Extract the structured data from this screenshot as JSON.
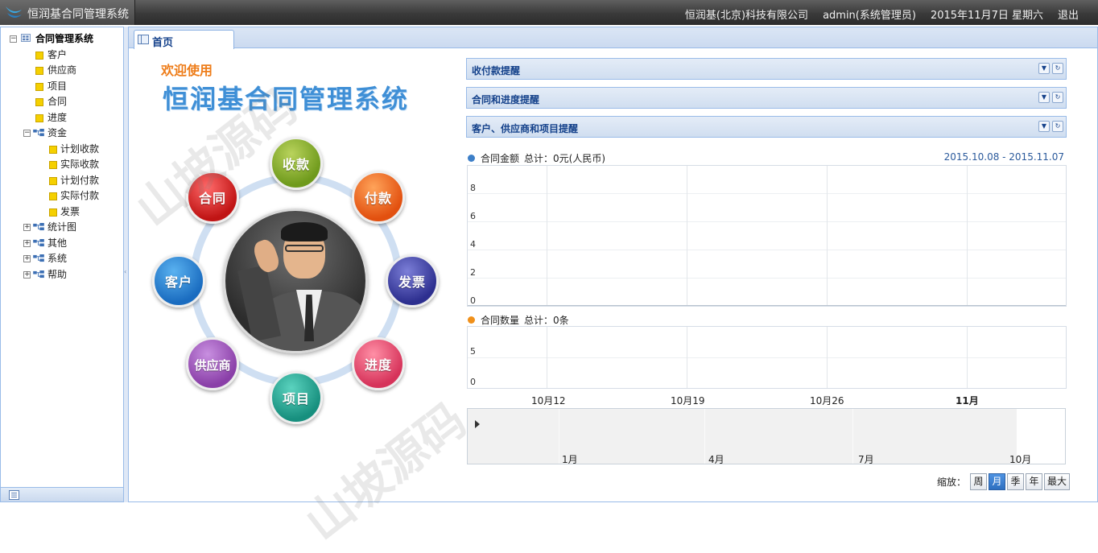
{
  "header": {
    "app_title": "恒润基合同管理系统",
    "company": "恒润基(北京)科技有限公司",
    "user": "admin(系统管理员)",
    "date": "2015年11月7日 星期六",
    "logout": "退出"
  },
  "sidebar": {
    "root": "合同管理系统",
    "items": [
      "客户",
      "供应商",
      "项目",
      "合同",
      "进度"
    ],
    "funds": {
      "label": "资金",
      "children": [
        "计划收款",
        "实际收款",
        "计划付款",
        "实际付款",
        "发票"
      ]
    },
    "collapsed": [
      "统计图",
      "其他",
      "系统",
      "帮助"
    ]
  },
  "tab": {
    "label": "首页"
  },
  "welcome": {
    "line1": "欢迎使用",
    "line2": "恒润基合同管理系统"
  },
  "watermark": "山坡源码",
  "orbit": {
    "shou": "收款",
    "fu": "付款",
    "fa": "发票",
    "jin": "进度",
    "xm": "项目",
    "gys": "供应商",
    "kh": "客户",
    "ht": "合同"
  },
  "panels": [
    "收付款提醒",
    "合同和进度提醒",
    "客户、供应商和项目提醒"
  ],
  "chart_data": [
    {
      "type": "line",
      "legend": "合同金额",
      "summary": "总计：0元(人民币)",
      "date_range": "2015.10.08 - 2015.11.07",
      "y_ticks": [
        "8",
        "6",
        "4",
        "2",
        "0"
      ],
      "series": [
        {
          "name": "合同金额",
          "values": []
        }
      ],
      "legend_color": "#3d7fc8"
    },
    {
      "type": "line",
      "legend": "合同数量",
      "summary": "总计：0条",
      "y_ticks": [
        "5",
        "0"
      ],
      "x_ticks": [
        "10月12",
        "10月19",
        "10月26",
        "11月"
      ],
      "series": [
        {
          "name": "合同数量",
          "values": []
        }
      ],
      "legend_color": "#f0901a"
    }
  ],
  "navigator": {
    "ticks": [
      "1月",
      "4月",
      "7月",
      "10月"
    ]
  },
  "zoom": {
    "label": "缩放：",
    "buttons": [
      "周",
      "月",
      "季",
      "年",
      "最大"
    ],
    "active": "月"
  }
}
